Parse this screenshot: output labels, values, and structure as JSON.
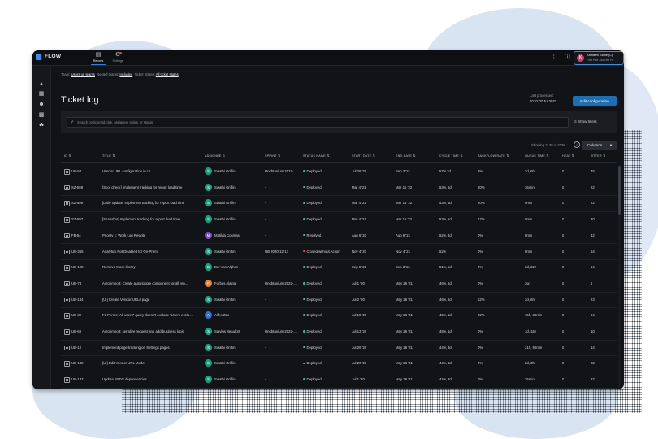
{
  "app": {
    "name": "FLOW"
  },
  "nav": {
    "reports": "Reports",
    "settings": "Settings"
  },
  "user": {
    "initial": "K",
    "name": "Kathleen Stone (C)",
    "org": "Flow Pilot - 5A Test Pa"
  },
  "filters": {
    "team_label": "Team:",
    "team_value": "Users on teams",
    "nested_label": "Nested teams:",
    "nested_value": "Included",
    "ticket_label": "Ticket States:",
    "ticket_value": "All ticket states"
  },
  "page": {
    "title": "Ticket log",
    "last_processed_label": "Last processed:",
    "last_processed_value": "10:11:07 Jul 2022",
    "edit_button": "Edit configuration"
  },
  "search": {
    "placeholder": "Search by ticket id, title, assignee, sprint, or status",
    "show_filters": "Show filters"
  },
  "table": {
    "showing": "Showing 2138 of 2138",
    "columns_button": "Columns",
    "headers": [
      "ID",
      "TITLE",
      "ASSIGNEE",
      "SPRINT",
      "STATUS NAME",
      "START DATE",
      "END DATE",
      "CYCLE TIME",
      "BACKFLOW RATE",
      "QUEUE TIME",
      "HEAT",
      "JITTER"
    ],
    "rows": [
      {
        "id": "UB-54",
        "title": "Vendor URL configuration in UI",
        "initial": "S",
        "assignee": "Swathi Griffin",
        "color": "#12a383",
        "sprint": "Unobtanium 2022-...",
        "status": "Deployed",
        "status_color": "#2ec27e",
        "start": "Jul 28 '20",
        "end": "Sep 3 '21",
        "cycle": "57w 2d",
        "backflow": "8%",
        "queue": "2d, 6h",
        "heat": "0",
        "jitter": "45"
      },
      {
        "id": "SZ-599",
        "title": "[Spot check] Implement tracking for report load time",
        "initial": "S",
        "assignee": "Swathi Griffin",
        "color": "#12a383",
        "sprint": "-",
        "status": "Deployed",
        "status_color": "#2ec27e",
        "start": "Mar 4 '21",
        "end": "Mar 15 '22",
        "cycle": "53w, 5d",
        "backflow": "20%",
        "queue": "36min",
        "heat": "0",
        "jitter": "22"
      },
      {
        "id": "SZ-598",
        "title": "[Daily update] Implement tracking for report load time",
        "initial": "S",
        "assignee": "Swathi Griffin",
        "color": "#12a383",
        "sprint": "-",
        "status": "Deployed",
        "status_color": "#2ec27e",
        "start": "Mar 4 '21",
        "end": "Mar 15 '22",
        "cycle": "53w, 5d",
        "backflow": "20%",
        "queue": "0min",
        "heat": "0",
        "jitter": "22"
      },
      {
        "id": "SZ-597",
        "title": "[Snapshot] Implement tracking for report load time",
        "initial": "S",
        "assignee": "Swathi Griffin",
        "color": "#12a383",
        "sprint": "-",
        "status": "Deployed",
        "status_color": "#2ec27e",
        "start": "Mar 4 '21",
        "end": "Mar 15 '22",
        "cycle": "53w, 5d",
        "backflow": "17%",
        "queue": "0min",
        "heat": "0",
        "jitter": "30"
      },
      {
        "id": "FB-54",
        "title": "Priority 1: Work Log Rewrite",
        "initial": "M",
        "assignee": "Matilda Cosmas",
        "color": "#7b4bd1",
        "sprint": "-",
        "status": "Resolved",
        "status_color": "#2ec27e",
        "start": "Aug 6 '20",
        "end": "Aug 9 '21",
        "cycle": "52w, 4d",
        "backflow": "0%",
        "queue": "0min",
        "heat": "0",
        "jitter": "42"
      },
      {
        "id": "UB-365",
        "title": "Analytics Not Disabled for On-Prem",
        "initial": "S",
        "assignee": "Swathi Griffin",
        "color": "#12a383",
        "sprint": "UB 2020-12-17",
        "status": "Closed without Action",
        "status_color": "#e5484d",
        "start": "Nov 4 '20",
        "end": "Nov 4 '21",
        "cycle": "52w",
        "backflow": "0%",
        "queue": "0min",
        "heat": "0",
        "jitter": "64"
      },
      {
        "id": "UB-198",
        "title": "Remove Mock library",
        "initial": "B",
        "assignee": "Bet Van Alphen",
        "color": "#12a383",
        "sprint": "-",
        "status": "Deployed",
        "status_color": "#2ec27e",
        "start": "Sep 5 '20",
        "end": "Sep 3 '21",
        "cycle": "51w, 5d",
        "backflow": "0%",
        "queue": "3d, 22h",
        "heat": "0",
        "jitter": "14"
      },
      {
        "id": "UB-73",
        "title": "Auto-import: Create auto-toggle component for all rep...",
        "initial": "F",
        "assignee": "Forbes Alaina",
        "color": "#e8832a",
        "sprint": "Unobtanium 2022-...",
        "status": "Deployed",
        "status_color": "#2ec27e",
        "start": "Jul 1 '20",
        "end": "May 26 '21",
        "cycle": "46w, 6d",
        "backflow": "0%",
        "queue": "3w",
        "heat": "0",
        "jitter": "6"
      },
      {
        "id": "UB-134",
        "title": "[UI] Create Vendor URLs page",
        "initial": "S",
        "assignee": "Swathi Griffin",
        "color": "#12a383",
        "sprint": "-",
        "status": "Deployed",
        "status_color": "#2ec27e",
        "start": "Jul 2 '20",
        "end": "May 26 '21",
        "cycle": "46w, 6d",
        "backflow": "12%",
        "queue": "2d, 6h",
        "heat": "0",
        "jitter": "23"
      },
      {
        "id": "UB-32",
        "title": "FL Perms \"All users\" query doesn't exclude \"Users exclu...",
        "initial": "A",
        "assignee": "Alfeo Zac",
        "color": "#2f6fd6",
        "sprint": "-",
        "status": "Deployed",
        "status_color": "#2ec27e",
        "start": "Jul 15 '20",
        "end": "May 26 '21",
        "cycle": "45w, 1d",
        "backflow": "22%",
        "queue": "15h, 35min",
        "heat": "0",
        "jitter": "64"
      },
      {
        "id": "UB-69",
        "title": "Auto-import: serialize request and add business logic",
        "initial": "S",
        "assignee": "Salvius Beaufort",
        "color": "#12a383",
        "sprint": "Unobtanium 2022-...",
        "status": "Deployed",
        "status_color": "#2ec27e",
        "start": "Jul 13 '20",
        "end": "May 26 '21",
        "cycle": "45w, 1d",
        "backflow": "0%",
        "queue": "1d, 15h",
        "heat": "0",
        "jitter": "10"
      },
      {
        "id": "UB-12",
        "title": "Implement page tracking on Settings pages",
        "initial": "S",
        "assignee": "Swathi Griffin",
        "color": "#12a383",
        "sprint": "-",
        "status": "Deployed",
        "status_color": "#2ec27e",
        "start": "Jul 29 '20",
        "end": "May 26 '21",
        "cycle": "44w, 3d",
        "backflow": "0%",
        "queue": "21h, 52min",
        "heat": "0",
        "jitter": "14"
      },
      {
        "id": "UB-135",
        "title": "[UI] Edit Vendor URL Model",
        "initial": "S",
        "assignee": "Swathi Griffin",
        "color": "#12a383",
        "sprint": "-",
        "status": "Deployed",
        "status_color": "#2ec27e",
        "start": "Jul 20 '20",
        "end": "May 26 '21",
        "cycle": "44w, 3d",
        "backflow": "0%",
        "queue": "2d, 3h",
        "heat": "0",
        "jitter": "22"
      },
      {
        "id": "UB-137",
        "title": "Update PSDS dependencies",
        "initial": "S",
        "assignee": "Swathi Griffin",
        "color": "#12a383",
        "sprint": "-",
        "status": "Deployed",
        "status_color": "#2ec27e",
        "start": "Jul 1 '20",
        "end": "May 26 '21",
        "cycle": "44w, 3d",
        "backflow": "0%",
        "queue": "36min",
        "heat": "0",
        "jitter": "27"
      }
    ]
  },
  "icons": {
    "reports": "reports-icon",
    "settings": "settings-icon",
    "grid": "apps-grid-icon",
    "help": "help-icon",
    "search": "search-icon",
    "filter": "filter-icon"
  }
}
